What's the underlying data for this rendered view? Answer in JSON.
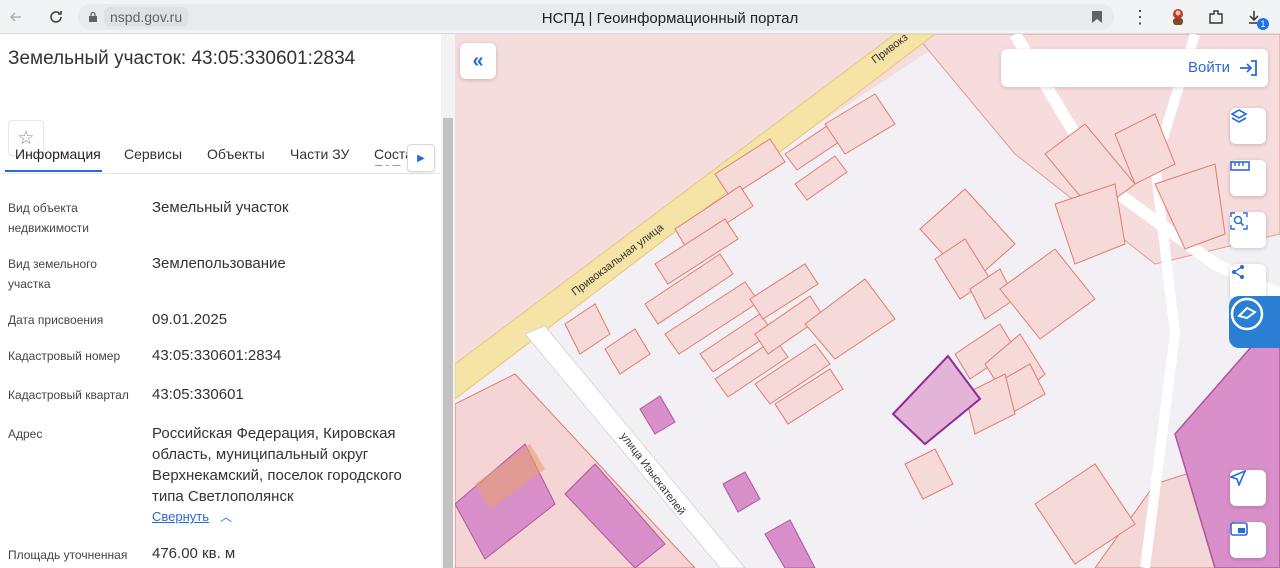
{
  "browser": {
    "url": "nspd.gov.ru",
    "title": "НСПД | Геоинформационный портал",
    "download_badge": "1"
  },
  "panel": {
    "title": "Земельный участок: 43:05:330601:2834",
    "tabs": [
      "Информация",
      "Сервисы",
      "Объекты",
      "Части ЗУ",
      "Состав ЕЗП"
    ],
    "active_tab": "Информация",
    "rows": [
      {
        "label": "Вид объекта недвижимости",
        "value": "Земельный участок"
      },
      {
        "label": "Вид земельного участка",
        "value": "Землепользование"
      },
      {
        "label": "Дата присвоения",
        "value": "09.01.2025"
      },
      {
        "label": "Кадастровый номер",
        "value": "43:05:330601:2834"
      },
      {
        "label": "Кадастровый квартал",
        "value": "43:05:330601"
      },
      {
        "label": "Адрес",
        "value": "Российская Федерация, Кировская область, муниципальный округ Верхнекамский, поселок городского типа Светлополянск"
      },
      {
        "label": "Площадь уточненная",
        "value": "476.00 кв. м"
      }
    ],
    "collapse_link": "Свернуть"
  },
  "map": {
    "login_label": "Войти",
    "street_1": "Привокзальная  улица",
    "street_1_top": "Привокз",
    "street_2": "улица Изыскателей",
    "colors": {
      "parcel_fill": "#f6d9d9",
      "parcel_stroke": "#e47b6b",
      "building_fill": "#d98fc9",
      "selected_fill": "#e3b3d8",
      "selected_stroke": "#8e2aa0",
      "road": "#f6e3a6",
      "accent": "#2a6ad8"
    }
  }
}
